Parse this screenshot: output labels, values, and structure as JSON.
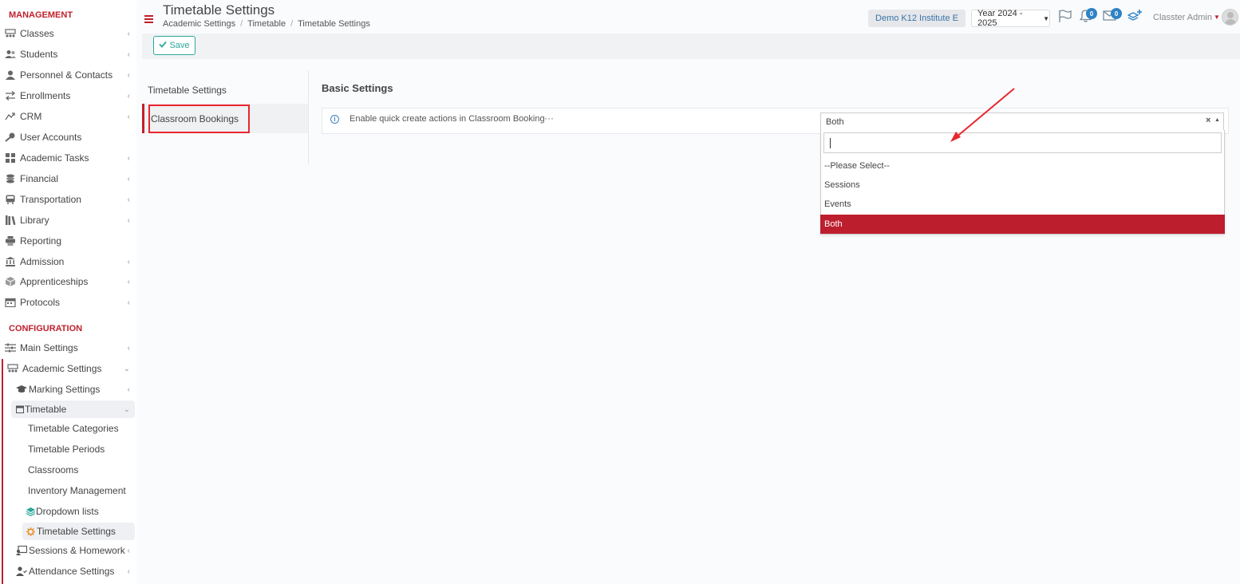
{
  "sidebar": {
    "management_title": "MANAGEMENT",
    "configuration_title": "CONFIGURATION",
    "management_items": [
      {
        "label": "Classes",
        "chev": "‹"
      },
      {
        "label": "Students",
        "chev": "‹"
      },
      {
        "label": "Personnel & Contacts",
        "chev": "‹"
      },
      {
        "label": "Enrollments",
        "chev": "‹"
      },
      {
        "label": "CRM",
        "chev": "‹"
      },
      {
        "label": "User Accounts",
        "chev": ""
      },
      {
        "label": "Academic Tasks",
        "chev": "‹"
      },
      {
        "label": "Financial",
        "chev": "‹"
      },
      {
        "label": "Transportation",
        "chev": "‹"
      },
      {
        "label": "Library",
        "chev": "‹"
      },
      {
        "label": "Reporting",
        "chev": ""
      },
      {
        "label": "Admission",
        "chev": "‹"
      },
      {
        "label": "Apprenticeships",
        "chev": "‹"
      },
      {
        "label": "Protocols",
        "chev": "‹"
      }
    ],
    "config_items": [
      {
        "label": "Main Settings",
        "chev": "‹"
      },
      {
        "label": "Academic Settings",
        "chev": "⌄"
      },
      {
        "label": "Marking Settings",
        "chev": "‹"
      },
      {
        "label": "Timetable",
        "chev": "⌄"
      },
      {
        "label": "Timetable Categories",
        "chev": ""
      },
      {
        "label": "Timetable Periods",
        "chev": ""
      },
      {
        "label": "Classrooms",
        "chev": ""
      },
      {
        "label": "Inventory Management",
        "chev": ""
      },
      {
        "label": "Dropdown lists",
        "chev": ""
      },
      {
        "label": "Timetable Settings",
        "chev": ""
      },
      {
        "label": "Sessions & Homework",
        "chev": "‹"
      },
      {
        "label": "Attendance Settings",
        "chev": "‹"
      }
    ]
  },
  "header": {
    "title": "Timetable Settings",
    "breadcrumb": [
      "Academic Settings",
      "Timetable",
      "Timetable Settings"
    ],
    "breadcrumb_sep": "/",
    "institute": "Demo K12 Institute E",
    "year": "Year 2024 - 2025",
    "notifications_count": "0",
    "messages_count": "0",
    "user": "Classter Admin"
  },
  "toolbar": {
    "save_label": "Save"
  },
  "settings_nav": {
    "items": [
      "Timetable Settings",
      "Classroom Bookings"
    ]
  },
  "content": {
    "section_title": "Basic Settings",
    "setting_label": "Enable quick create actions in Classroom Booking",
    "more": "···",
    "select_value": "Both",
    "select_clear": "×",
    "dropdown_options": [
      "--Please Select--",
      "Sessions",
      "Events",
      "Both"
    ],
    "selected_option": "Both"
  },
  "colors": {
    "accent_red": "#c0202c",
    "selected_bg": "#bd1e2d",
    "teal": "#2aa89a",
    "badge_blue": "#2d83c5",
    "annotation_red": "#e8262e"
  }
}
